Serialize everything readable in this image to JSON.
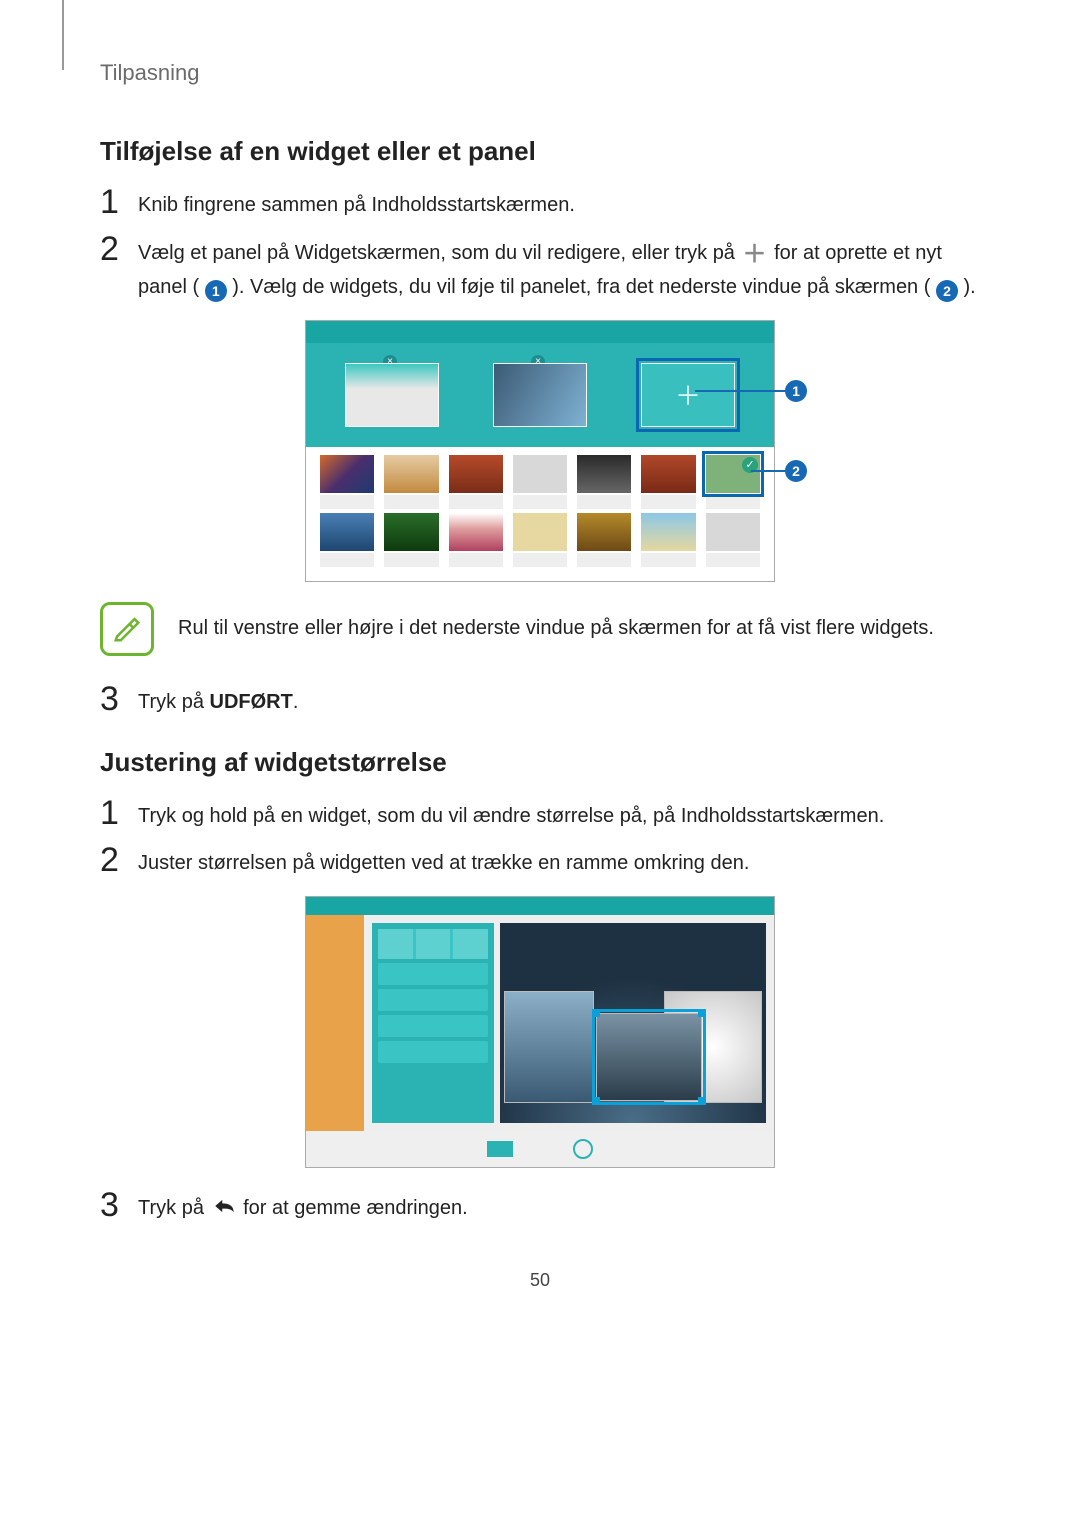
{
  "breadcrumb": "Tilpasning",
  "section1": {
    "heading": "Tilføjelse af en widget eller et panel",
    "steps": {
      "s1": {
        "num": "1",
        "text": "Knib fingrene sammen på Indholdsstartskærmen."
      },
      "s2": {
        "num": "2",
        "part1": "Vælg et panel på Widgetskærmen, som du vil redigere, eller tryk på ",
        "part2": " for at oprette et nyt panel ( ",
        "part3": " ). Vælg de widgets, du vil føje til panelet, fra det nederste vindue på skærmen ( ",
        "part4": " )."
      },
      "s3": {
        "num": "3",
        "pre": "Tryk på ",
        "bold": "UDFØRT",
        "post": "."
      }
    },
    "note": "Rul til venstre eller højre i det nederste vindue på skærmen for at få vist flere widgets.",
    "callouts": {
      "c1": "1",
      "c2": "2"
    }
  },
  "section2": {
    "heading": "Justering af widgetstørrelse",
    "steps": {
      "s1": {
        "num": "1",
        "text": "Tryk og hold på en widget, som du vil ændre størrelse på, på Indholdsstartskærmen."
      },
      "s2": {
        "num": "2",
        "text": "Juster størrelsen på widgetten ved at trække en ramme omkring den."
      },
      "s3": {
        "num": "3",
        "pre": "Tryk på ",
        "post": " for at gemme ændringen."
      }
    }
  },
  "pageNumber": "50"
}
